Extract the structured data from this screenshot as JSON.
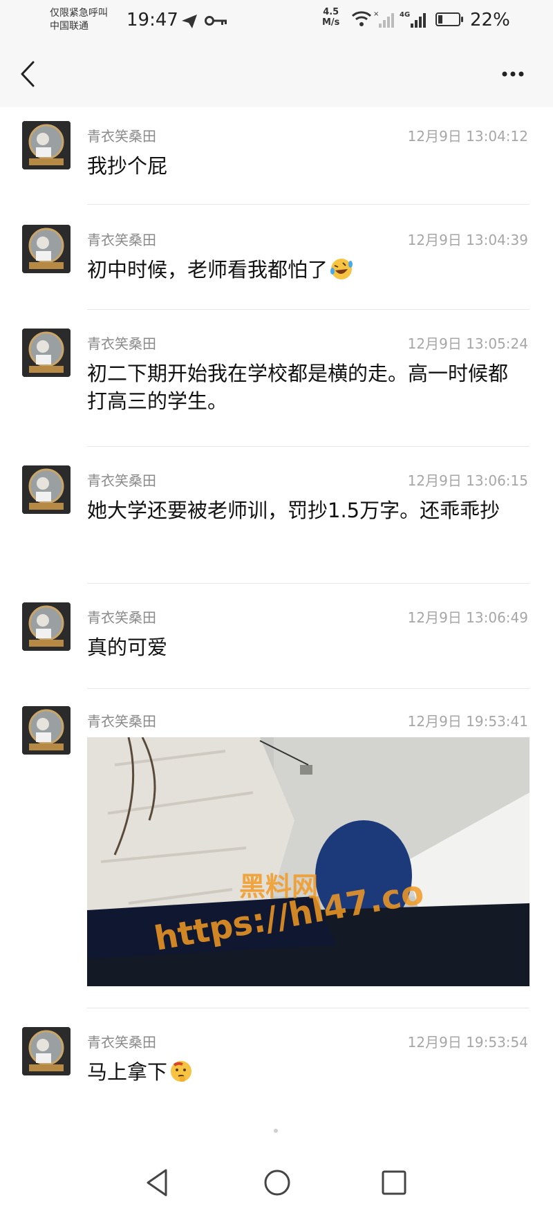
{
  "status_bar": {
    "carrier_line1": "仅限紧急呼叫",
    "carrier_line2": "中国联通",
    "time": "19:47",
    "speed_value": "4.5",
    "speed_unit": "M/s",
    "network_label": "4G",
    "battery_percent": "22%",
    "battery_level": 0.22
  },
  "messages": [
    {
      "sender": "青衣笑桑田",
      "time": "12月9日 13:04:12",
      "text": "我抄个屁"
    },
    {
      "sender": "青衣笑桑田",
      "time": "12月9日 13:04:39",
      "text": "初中时候，老师看我都怕了",
      "emoji": "laughing-crying-emoji"
    },
    {
      "sender": "青衣笑桑田",
      "time": "12月9日 13:05:24",
      "text": "初二下期开始我在学校都是横的走。高一时候都打高三的学生。"
    },
    {
      "sender": "青衣笑桑田",
      "time": "12月9日 13:06:15",
      "text": "她大学还要被老师训，罚抄1.5万字。还乖乖抄"
    },
    {
      "sender": "青衣笑桑田",
      "time": "12月9日 13:06:49",
      "text": "真的可爱"
    },
    {
      "sender": "青衣笑桑田",
      "time": "12月9日 19:53:41",
      "image": "photo-message",
      "watermark_line1": "黑料网",
      "watermark_line2": "https://hl47.co"
    },
    {
      "sender": "青衣笑桑田",
      "time": "12月9日 19:53:54",
      "text": "马上拿下",
      "emoji": "thinking-face-emoji"
    }
  ],
  "icons": {
    "back": "back-arrow-icon",
    "more": "more-dots-icon",
    "nav_back": "triangle-back-icon",
    "nav_home": "circle-home-icon",
    "nav_recent": "square-recent-icon"
  },
  "colors": {
    "sender": "#8a8a8a",
    "timestamp": "#a6a6a6",
    "watermark": "#f29a24"
  }
}
